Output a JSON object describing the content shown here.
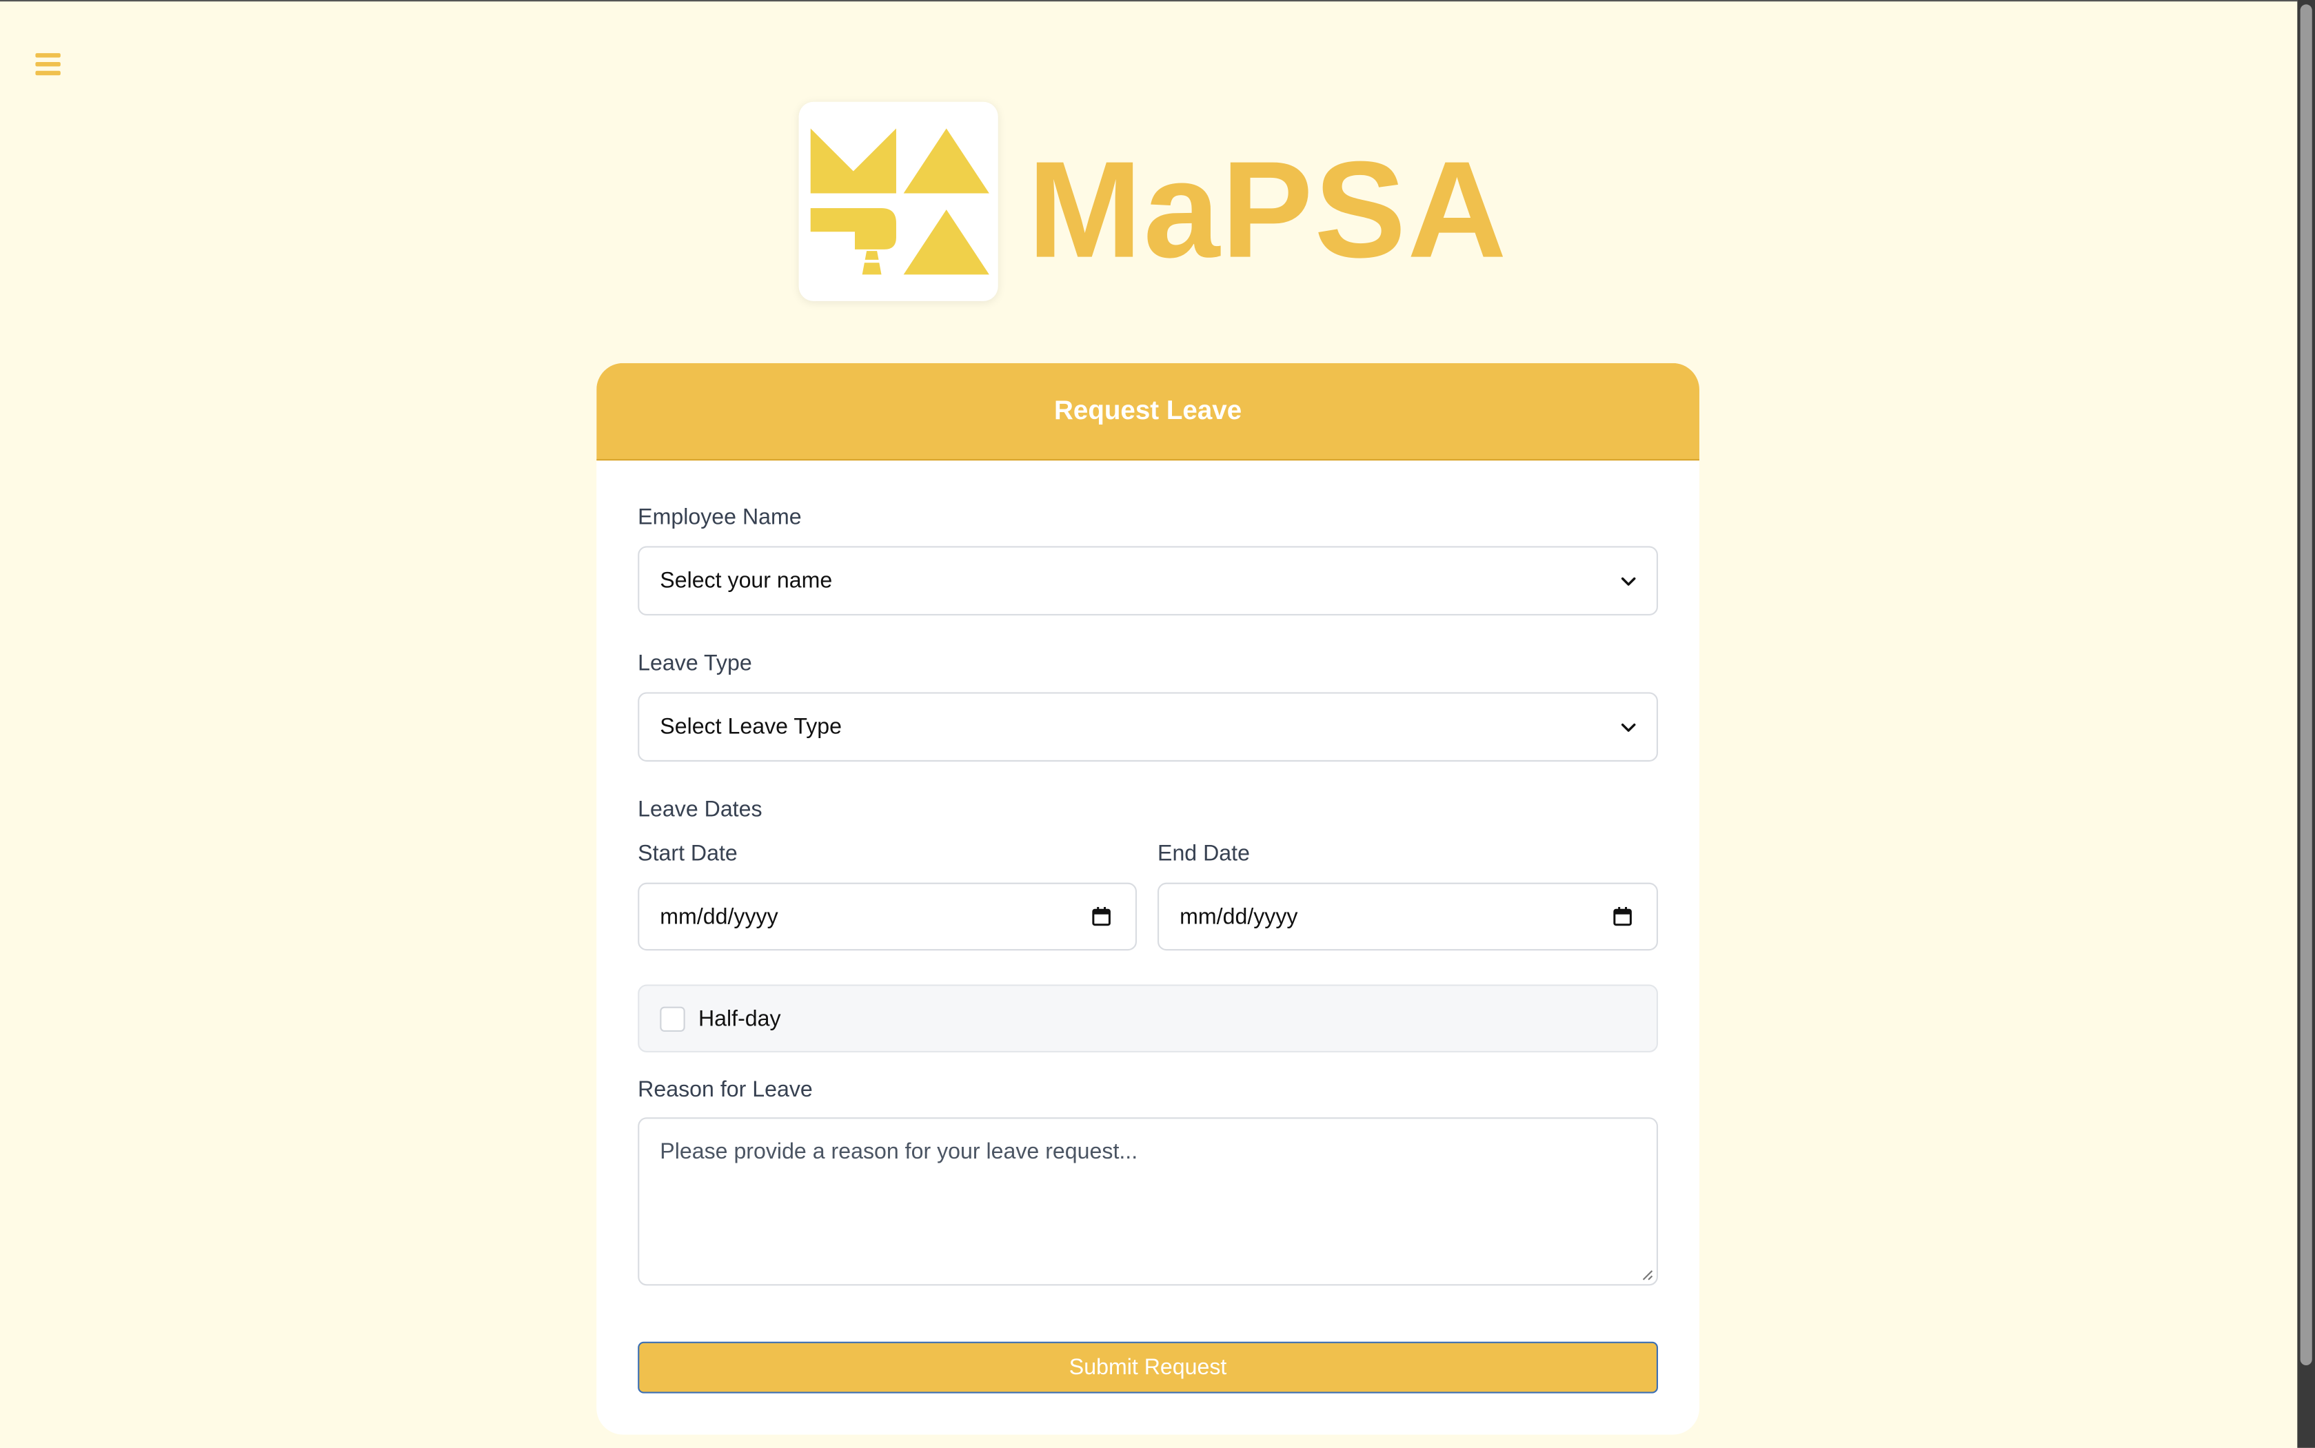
{
  "app": {
    "brand_name": "MaPSA",
    "accent_color": "#f0c04d",
    "background_color": "#fffbe6"
  },
  "nav": {
    "menu_icon": "hamburger-menu-icon"
  },
  "form": {
    "title": "Request Leave",
    "employee": {
      "label": "Employee Name",
      "selected": "Select your name"
    },
    "leave_type": {
      "label": "Leave Type",
      "selected": "Select Leave Type"
    },
    "dates": {
      "section_label": "Leave Dates",
      "start_label": "Start Date",
      "start_value": "mm/dd/yyyy",
      "end_label": "End Date",
      "end_value": "mm/dd/yyyy"
    },
    "half_day": {
      "label": "Half-day",
      "checked": false
    },
    "reason": {
      "label": "Reason for Leave",
      "placeholder": "Please provide a reason for your leave request..."
    },
    "submit_label": "Submit Request"
  }
}
